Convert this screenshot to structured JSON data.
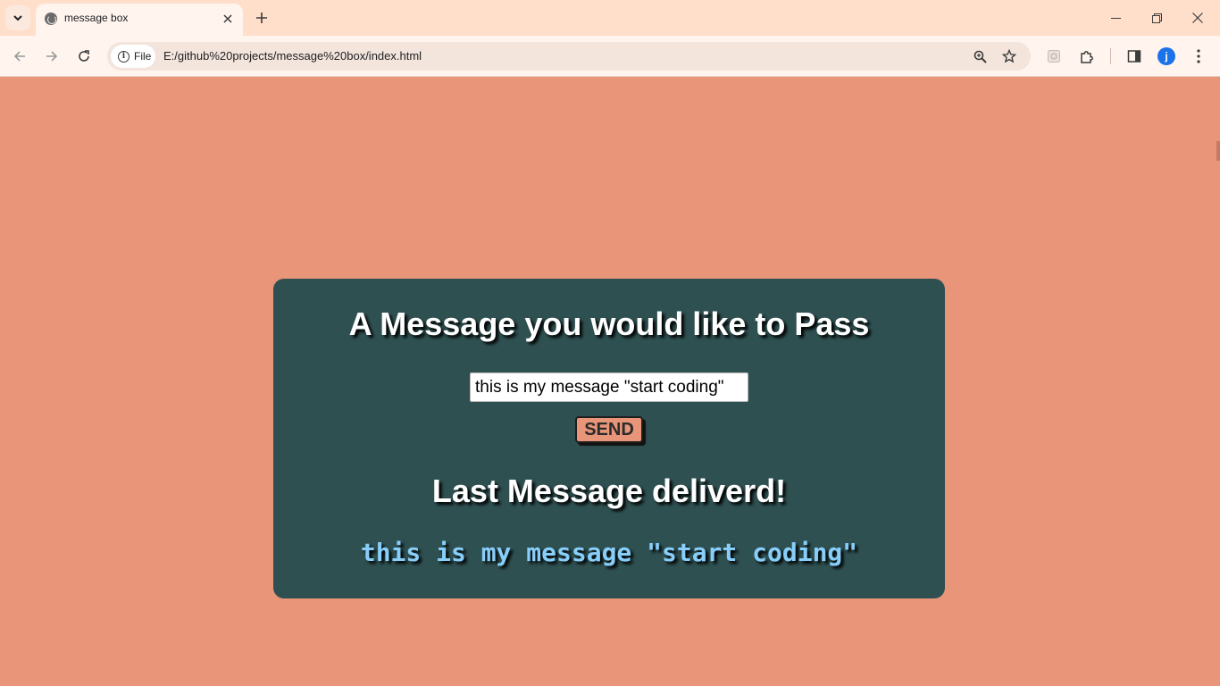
{
  "browser": {
    "tab_title": "message box",
    "address_chip": "File",
    "url": "E:/github%20projects/message%20box/index.html",
    "avatar_letter": "j",
    "accent_color": "#1a73e8"
  },
  "page": {
    "background_color": "#e9957a",
    "card_color": "#2f5051",
    "heading": "A Message you would like to Pass",
    "input_value": "this is my message \"start coding\"",
    "send_label": "SEND",
    "subheading": "Last Message deliverd!",
    "last_message": "this is my message \"start coding\"",
    "last_message_color": "#87cefa"
  },
  "icons": {
    "tab_search": "chevron-down-icon",
    "favicon": "globe-icon",
    "close": "close-icon",
    "new_tab": "plus-icon",
    "back": "arrow-left-icon",
    "forward": "arrow-right-icon",
    "reload": "reload-icon",
    "info": "info-icon",
    "zoom": "zoom-icon",
    "bookmark": "star-icon",
    "extension": "puzzle-icon",
    "side_panel": "side-panel-icon",
    "menu": "kebab-menu-icon"
  }
}
